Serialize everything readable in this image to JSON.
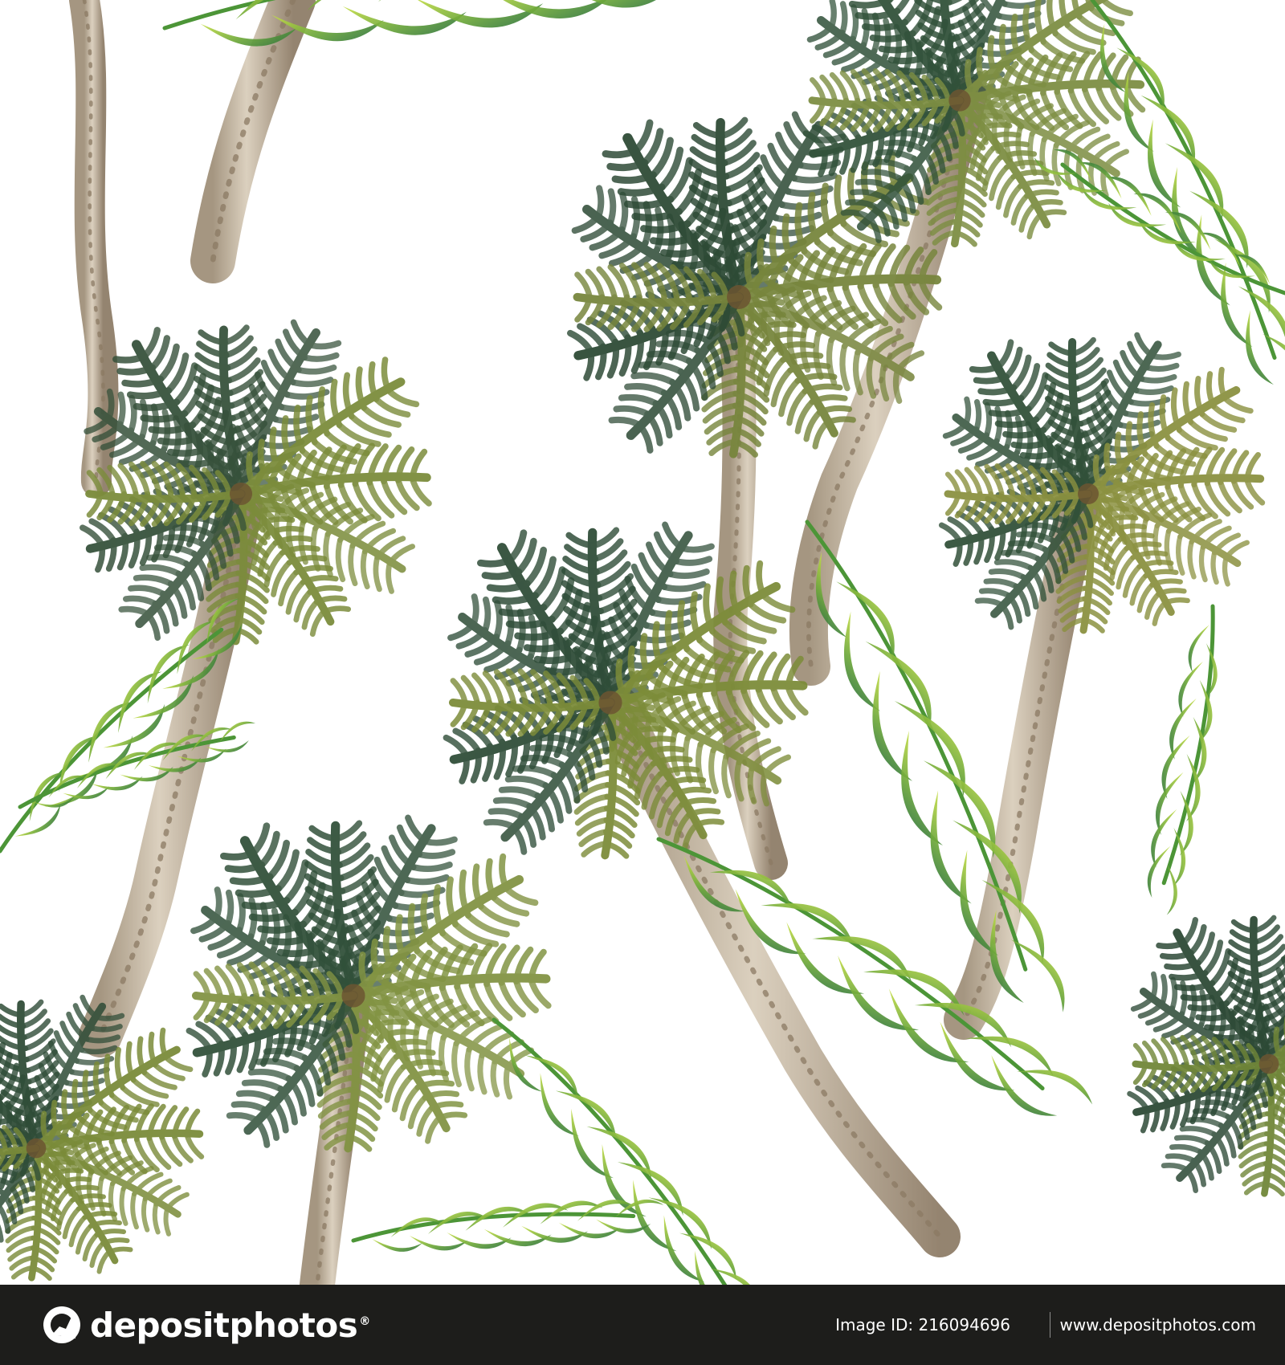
{
  "watermark": {
    "logo_text": "depositphotos",
    "logo_trademark": "®",
    "image_id_label": "Image ID:",
    "image_id": "216094696",
    "site_url": "www.depositphotos.com"
  },
  "artwork": {
    "subject": "watercolor palm tree seamless pattern",
    "colors": {
      "background": "#ffffff",
      "dark_green": "#274b34",
      "mid_green": "#5b8f35",
      "olive": "#7c8b3f",
      "light_green": "#8fbd2f",
      "yellow_green": "#c3d94d",
      "trunk": "#c8b79c",
      "trunk_shadow": "#8b7963"
    },
    "palms": [
      {
        "crown_color": "#36513b",
        "outer_color": "#7b8c3b"
      },
      {
        "crown_color": "#2d4a35",
        "outer_color": "#77853c"
      },
      {
        "crown_color": "#31513a",
        "outer_color": "#7d8e42"
      },
      {
        "crown_color": "#315039",
        "outer_color": "#8b9140"
      },
      {
        "crown_color": "#2f4d38",
        "outer_color": "#7c8c39"
      },
      {
        "crown_color": "#31503a",
        "outer_color": "#829343"
      },
      {
        "crown_color": "#2f4c37",
        "outer_color": "#7a8b39"
      },
      {
        "crown_color": "#2c4935",
        "outer_color": "#708638"
      }
    ]
  }
}
